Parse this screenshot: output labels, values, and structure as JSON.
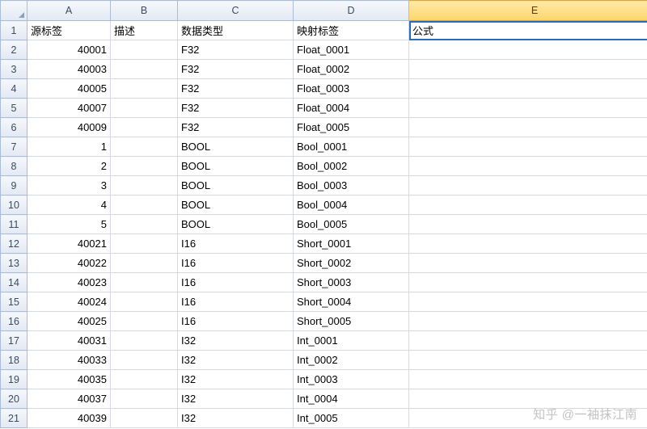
{
  "columns": [
    "A",
    "B",
    "C",
    "D",
    "E"
  ],
  "headers": {
    "A": "源标签",
    "B": "描述",
    "C": "数据类型",
    "D": "映射标签",
    "E": "公式"
  },
  "rows": [
    {
      "n": 1,
      "A": "源标签",
      "B": "描述",
      "C": "数据类型",
      "D": "映射标签",
      "E": "公式"
    },
    {
      "n": 2,
      "A": "40001",
      "B": "",
      "C": "F32",
      "D": "Float_0001",
      "E": ""
    },
    {
      "n": 3,
      "A": "40003",
      "B": "",
      "C": "F32",
      "D": "Float_0002",
      "E": ""
    },
    {
      "n": 4,
      "A": "40005",
      "B": "",
      "C": "F32",
      "D": "Float_0003",
      "E": ""
    },
    {
      "n": 5,
      "A": "40007",
      "B": "",
      "C": "F32",
      "D": "Float_0004",
      "E": ""
    },
    {
      "n": 6,
      "A": "40009",
      "B": "",
      "C": "F32",
      "D": "Float_0005",
      "E": ""
    },
    {
      "n": 7,
      "A": "1",
      "B": "",
      "C": "BOOL",
      "D": "Bool_0001",
      "E": ""
    },
    {
      "n": 8,
      "A": "2",
      "B": "",
      "C": "BOOL",
      "D": "Bool_0002",
      "E": ""
    },
    {
      "n": 9,
      "A": "3",
      "B": "",
      "C": "BOOL",
      "D": "Bool_0003",
      "E": ""
    },
    {
      "n": 10,
      "A": "4",
      "B": "",
      "C": "BOOL",
      "D": "Bool_0004",
      "E": ""
    },
    {
      "n": 11,
      "A": "5",
      "B": "",
      "C": "BOOL",
      "D": "Bool_0005",
      "E": ""
    },
    {
      "n": 12,
      "A": "40021",
      "B": "",
      "C": "I16",
      "D": "Short_0001",
      "E": ""
    },
    {
      "n": 13,
      "A": "40022",
      "B": "",
      "C": "I16",
      "D": "Short_0002",
      "E": ""
    },
    {
      "n": 14,
      "A": "40023",
      "B": "",
      "C": "I16",
      "D": "Short_0003",
      "E": ""
    },
    {
      "n": 15,
      "A": "40024",
      "B": "",
      "C": "I16",
      "D": "Short_0004",
      "E": ""
    },
    {
      "n": 16,
      "A": "40025",
      "B": "",
      "C": "I16",
      "D": "Short_0005",
      "E": ""
    },
    {
      "n": 17,
      "A": "40031",
      "B": "",
      "C": "I32",
      "D": "Int_0001",
      "E": ""
    },
    {
      "n": 18,
      "A": "40033",
      "B": "",
      "C": "I32",
      "D": "Int_0002",
      "E": ""
    },
    {
      "n": 19,
      "A": "40035",
      "B": "",
      "C": "I32",
      "D": "Int_0003",
      "E": ""
    },
    {
      "n": 20,
      "A": "40037",
      "B": "",
      "C": "I32",
      "D": "Int_0004",
      "E": ""
    },
    {
      "n": 21,
      "A": "40039",
      "B": "",
      "C": "I32",
      "D": "Int_0005",
      "E": ""
    }
  ],
  "selected_column": "E",
  "selected_cell": "E1",
  "watermark": "知乎 @一袖抹江南"
}
